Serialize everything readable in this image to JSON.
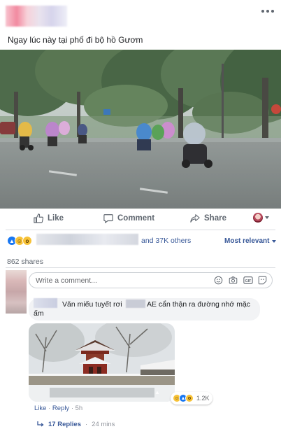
{
  "post": {
    "text": "Ngay lúc này tại phố đi bộ hồ Gươm"
  },
  "actions": {
    "like": "Like",
    "comment": "Comment",
    "share": "Share"
  },
  "reactions": {
    "others": "and 37K others",
    "sort": "Most relevant"
  },
  "shares": "862 shares",
  "composer": {
    "placeholder": "Write a comment..."
  },
  "comment": {
    "text_part1": "Văn miếu tuyết rơi",
    "text_part2": "AE cẩn thận ra đường nhớ mặc",
    "text_part3": "ấm",
    "reaction_count": "1.2K",
    "like": "Like",
    "dot1": " · ",
    "reply": "Reply",
    "dot2": " · ",
    "time": "5h"
  },
  "replies": {
    "label": "17 Replies",
    "dot": " · ",
    "time": "24 mins"
  },
  "colors": {
    "link_blue": "#385898",
    "like_blue": "#1877f2"
  }
}
